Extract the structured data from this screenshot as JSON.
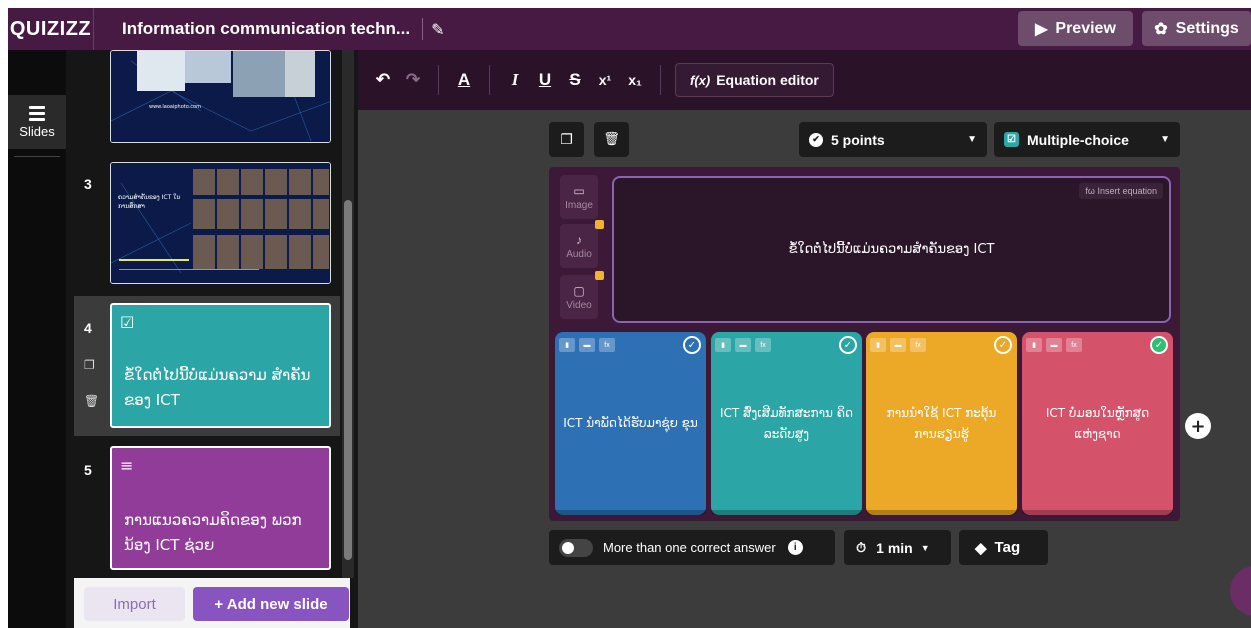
{
  "app": {
    "logo": "QUIZIZZ",
    "title": "Information communication techn..."
  },
  "header": {
    "preview_label": "Preview",
    "settings_label": "Settings"
  },
  "rail": {
    "slides_label": "Slides"
  },
  "slides": [
    {
      "number": "3",
      "thumb_text": "ຄວາມສຳຄັນຂອງ ICT ໃນການສຶກສາ"
    },
    {
      "number": "4",
      "text": "ຂໍ້ໃດຕໍ່ໄປນີ້ບໍ່ແມ່ນຄວາມ ສໍາຄັນຂອງ ICT"
    },
    {
      "number": "5",
      "text": "ການແນວຄວາມຄິດຂອງ ພວກນ້ອງ ICT ຊ່ວຍ"
    }
  ],
  "slide2_caption": "www.laoaiphoto.com",
  "panel": {
    "import_label": "Import",
    "add_slide_label": "+ Add new slide"
  },
  "toolbar": {
    "equation_label": "Equation editor",
    "eq_fx": "f(x)"
  },
  "question": {
    "points": "5 points",
    "type": "Multiple-choice",
    "insert_equation": "fω Insert equation",
    "text": "ຂໍ້ໃດຕໍ່ໄປນີ້ບໍ່ແມ່ນຄວາມສຳຄັນຂອງ ICT",
    "media": [
      "Image",
      "Audio",
      "Video"
    ]
  },
  "answers": [
    {
      "text": "ICT ນຳພັດໄດ້ຮັບມາຊຸ່ຍ ຂຸນ",
      "color": "#2d70b4",
      "correct": false
    },
    {
      "text": "ICT ສົ່ງເສີມທັກສະການ ຄິດລະດັບສູງ",
      "color": "#2ba5a5",
      "correct": false
    },
    {
      "text": "ການນຳໃຊ້ ICT ກະຕຸ້ນ ການຮຽນຮູ້",
      "color": "#eca928",
      "correct": false
    },
    {
      "text": "ICT ບໍ່ມອນໃນຫຼັກສູດ ແຫ່ງຊາດ",
      "color": "#d4536a",
      "correct": true
    }
  ],
  "options": {
    "multi_correct_label": "More than one correct answer",
    "time": "1 min",
    "tag_label": "Tag"
  }
}
